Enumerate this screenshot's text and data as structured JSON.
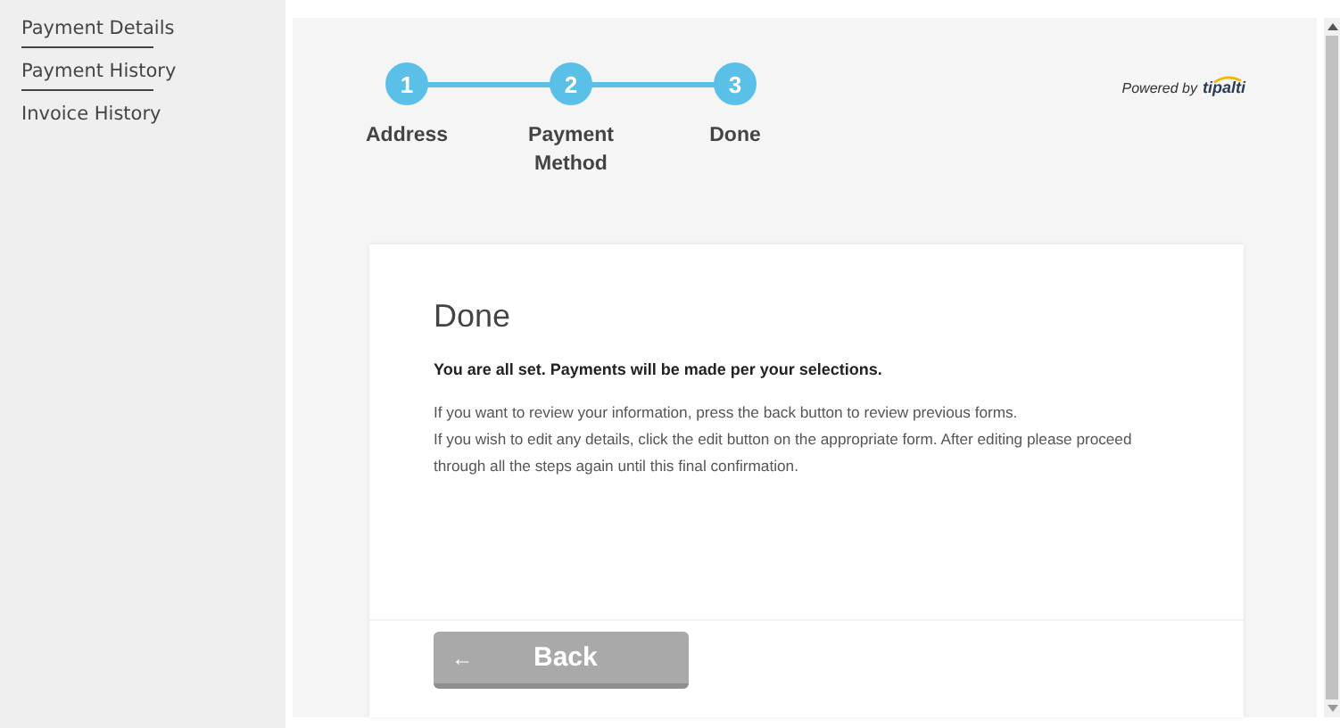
{
  "sidebar": {
    "items": [
      {
        "label": "Payment Details",
        "divider": true
      },
      {
        "label": "Payment History",
        "divider": true
      },
      {
        "label": "Invoice History",
        "divider": false
      }
    ]
  },
  "stepper": {
    "steps": [
      {
        "number": "1",
        "label": "Address",
        "completed": true
      },
      {
        "number": "2",
        "label": "Payment Method",
        "completed": true
      },
      {
        "number": "3",
        "label": "Done",
        "completed": true
      }
    ]
  },
  "branding": {
    "prefix": "Powered by",
    "logo": "tipalti"
  },
  "card": {
    "title": "Done",
    "lead": "You are all set. Payments will be made per your selections.",
    "paragraphs": [
      "If you want to review your information, press the back button to review previous forms.",
      "If you wish to edit any details, click the edit button on the appropriate form. After editing please proceed through all the steps again until this final confirmation."
    ],
    "back_button": {
      "arrow": "←",
      "label": "Back"
    }
  }
}
